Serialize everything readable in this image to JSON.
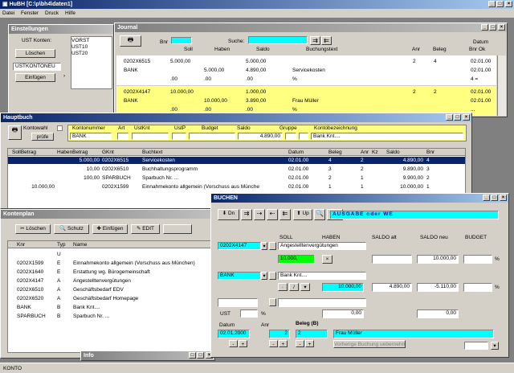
{
  "app": {
    "title": "HuBH  [C:\\p\\bh4\\daten1]"
  },
  "menu": [
    "Datei",
    "Fenster",
    "Druck",
    "Hilfe"
  ],
  "status": "KONTO",
  "einst": {
    "title": "Einstellungen",
    "ust_label": "UST Konten:",
    "list": [
      "VORST",
      "UST10",
      "UST20"
    ],
    "loeschen": "Löschen",
    "input": "USTKONTONEU",
    "einfuegen": "Einfügen"
  },
  "journal": {
    "title": "Journal",
    "labels": {
      "bnr": "Bnr",
      "soll": "Soll",
      "haben": "Haben",
      "saldo": "Saldo",
      "suche": "Suche:",
      "text": "Buchungstext",
      "anr": "Anr",
      "beleg": "Beleg",
      "datum": "Datum",
      "bnrok": "Bnr Ok"
    },
    "entries": [
      {
        "a": "0202X6515",
        "b": "5.000,00",
        "c": "",
        "d": "5.000,00",
        "t": "",
        "n": "2",
        "g": "4",
        "dt": "02.01.00"
      },
      {
        "a": "BANK",
        "b": "",
        "c": "5.000,00",
        "d": "4.890,00",
        "t": "Servicekosten",
        "n": "",
        "g": "",
        "dt": "02.01.00"
      },
      {
        "a": "",
        "b": ".00",
        "c": ".00",
        "d": ".00",
        "t": "%",
        "n": "",
        "g": "",
        "dt": "4 ="
      },
      {
        "a": "0202X4147",
        "b": "10.000,00",
        "c": "",
        "d": "1.000,00",
        "t": "",
        "n": "2",
        "g": "2",
        "dt": "02.01.00"
      },
      {
        "a": "BANK",
        "b": "",
        "c": "10.000,00",
        "d": "3.890,00",
        "t": "Frau Müller",
        "n": "",
        "g": "",
        "dt": "02.01.00"
      },
      {
        "a": "",
        "b": ".00",
        "c": ".00",
        "d": ".00",
        "t": "%",
        "n": "",
        "g": "",
        "dt": "..."
      }
    ]
  },
  "hb": {
    "title": "Hauptbuch",
    "labels": {
      "kontowahl": "Kontowahl",
      "prufe": "prüfe",
      "kontonummer": "Kontonummer",
      "art": "Art",
      "ustkt": "UstKnt",
      "ustp": "UstP",
      "budget": "Budget",
      "saldo": "Saldo",
      "gruppe": "Gruppe",
      "bez": "Kontobezeichnung"
    },
    "konto": "BANK",
    "saldo": "4.890,00",
    "bez": "Bank Knt....",
    "cols": [
      "SollBetrag",
      "HabenBetrag",
      "GKnt",
      "Buchtext",
      "Datum",
      "Beleg",
      "Anr",
      "Kz",
      "Saldo",
      "Bnr"
    ],
    "rows": [
      [
        "",
        "5.000,00",
        "0202X6515",
        "Servicekosten",
        "02.01.00",
        "4",
        "2",
        "",
        "4.890,00",
        "4"
      ],
      [
        "",
        "10,00",
        "0202X6510",
        "Buchhaltungsprogramm",
        "02.01.00",
        "3",
        "2",
        "",
        "9.890,00",
        "3"
      ],
      [
        "",
        "100,00",
        "SPARBUCH",
        "Sparbuch Nr. ...",
        "02.01.00",
        "2",
        "1",
        "",
        "9.900,00",
        "2"
      ],
      [
        "10.000,00",
        "",
        "0202X1599",
        "Einnahmekonto allgemein (Vorschuss aus Münche",
        "02.01.00",
        "1",
        "1",
        "",
        "10.000,00",
        "1"
      ]
    ]
  },
  "kp": {
    "title": "Kontenplan",
    "tb": [
      "Löschen",
      "Schutz",
      "Einfügen",
      "EDIT"
    ],
    "cols": [
      "Knr",
      "Typ",
      "Name"
    ],
    "rows": [
      [
        "",
        "U",
        ""
      ],
      [
        "0202X1599",
        "E",
        "Einnahmekonto allgemein (Vorschuss aus München)"
      ],
      [
        "0202X1640",
        "E",
        "Erstattung wg. Bürogemeinschaft"
      ],
      [
        "0202X4147",
        "A",
        "Angestelltenvergütungen"
      ],
      [
        "0202X6510",
        "A",
        "Geschäftsbedarf EDV"
      ],
      [
        "0202X6520",
        "A",
        "Geschäftsbedarf Homepage"
      ],
      [
        "BANK",
        "B",
        "Bank Knt...."
      ],
      [
        "SPARBUCH",
        "B",
        "Sparbuch Nr. ..."
      ]
    ]
  },
  "info": {
    "title": "Info"
  },
  "buchen": {
    "title": "BUCHEN",
    "tb": [
      "Dn",
      "Up",
      "UST"
    ],
    "mode": "AUSGABE oder WE",
    "hdr": [
      "SOLL",
      "HABEN",
      "SALDO alt",
      "SALDO neu",
      "BUDGET"
    ],
    "soll_konto": "0202X4147",
    "soll_text": "Angestelltenvergütungen",
    "soll_green": "10.000,",
    "soll_neu": "10.000,00",
    "pct": "%",
    "haben_konto": "BANK",
    "haben_text": "Bank Knt....",
    "haben_betrag": "10.000,00",
    "haben_alt": "4.890,00",
    "haben_neu": "-5.110,00",
    "ust": "UST",
    "ust_pct": "%",
    "zero1": "0,00",
    "zero2": "0,00",
    "datum_l": "Datum",
    "anr_l": "Anr",
    "beleg_l": "Beleg (B)",
    "datum": "02.01.2000",
    "anr": "2",
    "beleg": "2",
    "text": "Frau Müller",
    "prev": "Vorherige Buchung uebernehmen"
  },
  "colors": {
    "title_active": "#0a246a",
    "cyan": "#00ffff",
    "yellow": "#ffff80",
    "green": "#00ff00"
  }
}
